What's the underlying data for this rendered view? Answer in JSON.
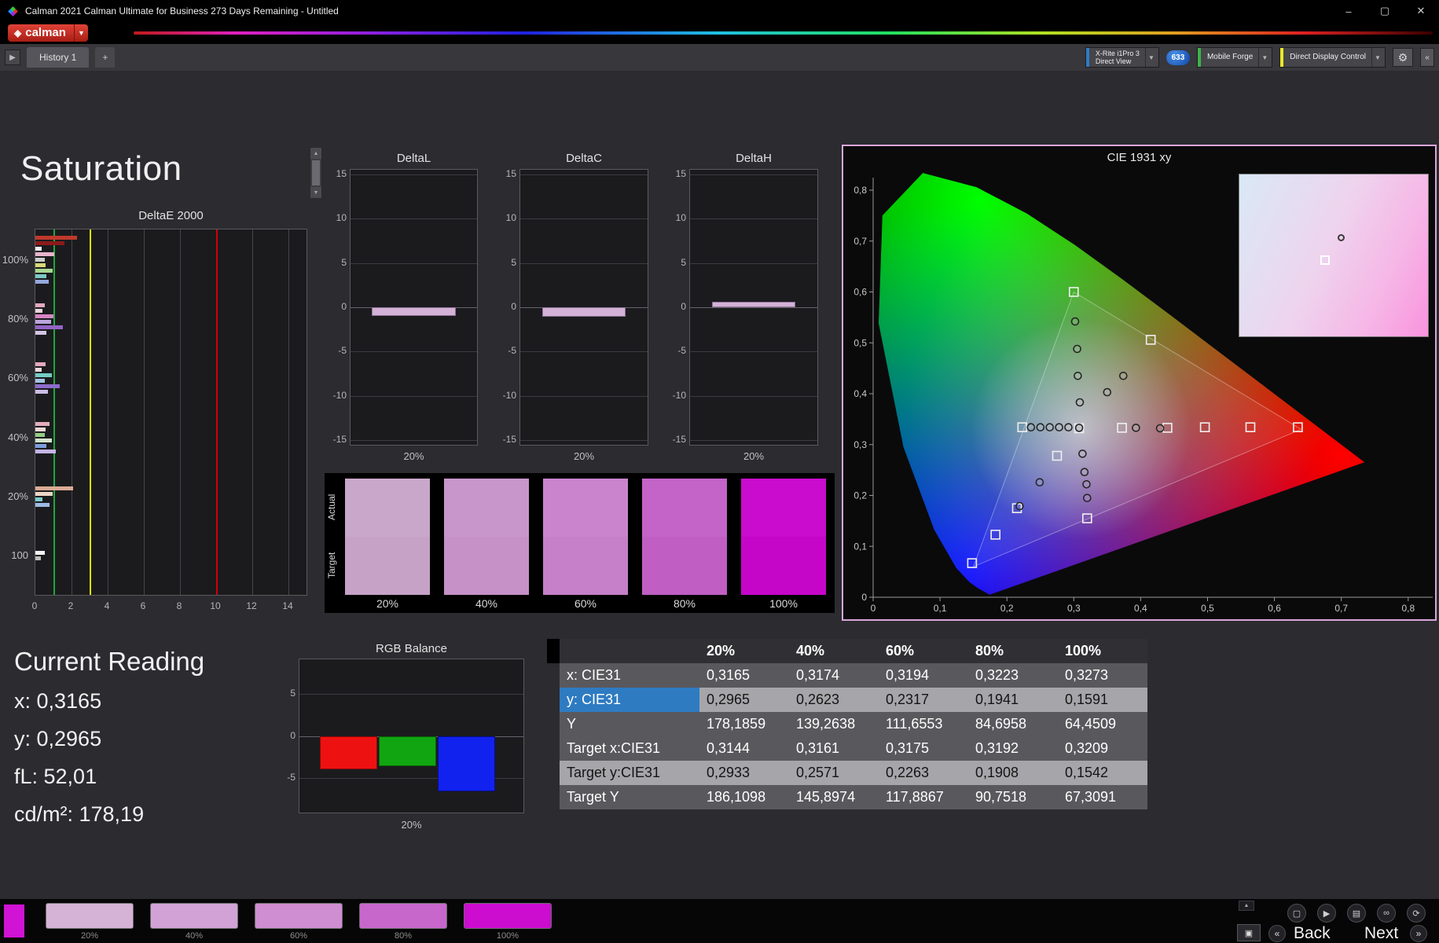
{
  "window": {
    "title": "Calman 2021 Calman Ultimate for Business 273 Days Remaining  - Untitled",
    "controls": {
      "minimize": "–",
      "maximize": "▢",
      "close": "✕"
    }
  },
  "logo": {
    "text": "calman",
    "diamond": "◈",
    "caret": "▼"
  },
  "tabbar": {
    "nav_arrow": "▶",
    "tabs": [
      {
        "label": "History 1"
      }
    ],
    "add_label": "+"
  },
  "meterbar": {
    "meter": {
      "line1": "X-Rite i1Pro 3",
      "line2": "Direct View",
      "accent": "#2f7cc4",
      "caret": "▼"
    },
    "badge": {
      "text": "633"
    },
    "source": {
      "label": "Mobile Forge",
      "accent": "#3cb44a",
      "caret": "▼"
    },
    "display_control": {
      "label": "Direct Display Control",
      "accent": "#e8e82a",
      "caret": "▼"
    },
    "gear": "⚙",
    "collapse": "«"
  },
  "page": {
    "title": "Saturation"
  },
  "current_reading": {
    "title": "Current Reading",
    "lines": [
      {
        "text": "x: 0,3165"
      },
      {
        "text": "y: 0,2965"
      },
      {
        "text": "fL: 52,01"
      },
      {
        "text": "cd/m²: 178,19"
      }
    ]
  },
  "bottombar": {
    "back_label": "Back",
    "next_label": "Next",
    "back_chevron": "«",
    "next_chevron": "»",
    "icons": [
      "▢",
      "▶",
      "▤",
      "∞",
      "⟳"
    ],
    "selected_color": "#d013d4",
    "thumbnails": [
      {
        "label": "20%",
        "color": "#d5b3d6"
      },
      {
        "label": "40%",
        "color": "#d2a1d5"
      },
      {
        "label": "60%",
        "color": "#cf8dd2"
      },
      {
        "label": "80%",
        "color": "#c767cb"
      },
      {
        "label": "100%",
        "color": "#cc0ccf"
      }
    ]
  },
  "chart_data": [
    {
      "id": "deltae2000",
      "type": "bar",
      "orientation": "horizontal",
      "title": "DeltaE 2000",
      "xlim": [
        0,
        15
      ],
      "xticks": [
        0,
        2,
        4,
        6,
        8,
        10,
        12,
        14
      ],
      "reference_lines": [
        {
          "value": 1,
          "color": "#1fa83c"
        },
        {
          "value": 3,
          "color": "#e8e000"
        },
        {
          "value": 10,
          "color": "#d40000"
        }
      ],
      "groups": [
        {
          "label": "100%",
          "bars": [
            {
              "color": "#c0392b",
              "value": 2.3
            },
            {
              "color": "#8b1a1a",
              "value": 1.6
            },
            {
              "color": "#f0f0f0",
              "value": 0.35
            },
            {
              "color": "#e8b4cc",
              "value": 1.05
            },
            {
              "color": "#cccccc",
              "value": 0.5
            },
            {
              "color": "#d8d878",
              "value": 0.55
            },
            {
              "color": "#a8d890",
              "value": 0.95
            },
            {
              "color": "#7cc8c4",
              "value": 0.6
            },
            {
              "color": "#94a8dc",
              "value": 0.75
            }
          ]
        },
        {
          "label": "80%",
          "bars": [
            {
              "color": "#e4a8bc",
              "value": 0.5
            },
            {
              "color": "#ecd4dc",
              "value": 0.4
            },
            {
              "color": "#d884c4",
              "value": 1.0
            },
            {
              "color": "#bca4dc",
              "value": 0.85
            },
            {
              "color": "#9464c4",
              "value": 1.5
            },
            {
              "color": "#d4c4e4",
              "value": 0.6
            }
          ]
        },
        {
          "label": "60%",
          "bars": [
            {
              "color": "#e4a8bc",
              "value": 0.55
            },
            {
              "color": "#ecd8dc",
              "value": 0.35
            },
            {
              "color": "#74ccc4",
              "value": 0.9
            },
            {
              "color": "#a4c4e4",
              "value": 0.5
            },
            {
              "color": "#8c6ccc",
              "value": 1.35
            },
            {
              "color": "#ccbce4",
              "value": 0.7
            }
          ]
        },
        {
          "label": "40%",
          "bars": [
            {
              "color": "#e4acbc",
              "value": 0.8
            },
            {
              "color": "#ecd8d4",
              "value": 0.55
            },
            {
              "color": "#94cc84",
              "value": 0.5
            },
            {
              "color": "#d4e4cc",
              "value": 0.9
            },
            {
              "color": "#7c9cdc",
              "value": 0.6
            },
            {
              "color": "#c4b4e4",
              "value": 1.15
            }
          ]
        },
        {
          "label": "20%",
          "bars": [
            {
              "color": "#dcac94",
              "value": 2.1
            },
            {
              "color": "#ecd4c4",
              "value": 0.95
            },
            {
              "color": "#7ccccc",
              "value": 0.4
            },
            {
              "color": "#9cbce4",
              "value": 0.8
            }
          ]
        },
        {
          "label": "100",
          "bars": [
            {
              "color": "#f4f4f4",
              "value": 0.5
            },
            {
              "color": "#bcbcbc",
              "value": 0.3
            }
          ]
        }
      ]
    },
    {
      "id": "deltaL",
      "type": "bar",
      "title": "DeltaL",
      "categories": [
        "20%"
      ],
      "values": [
        -1.0
      ],
      "ylim": [
        -15,
        15
      ],
      "yticks": [
        15,
        10,
        5,
        0,
        -5,
        -10,
        -15
      ],
      "bar_color": "#d2b2d6"
    },
    {
      "id": "deltaC",
      "type": "bar",
      "title": "DeltaC",
      "categories": [
        "20%"
      ],
      "values": [
        -1.1
      ],
      "ylim": [
        -15,
        15
      ],
      "yticks": [
        15,
        10,
        5,
        0,
        -5,
        -10,
        -15
      ],
      "bar_color": "#d2b2d6"
    },
    {
      "id": "deltaH",
      "type": "bar",
      "title": "DeltaH",
      "categories": [
        "20%"
      ],
      "values": [
        0.6
      ],
      "ylim": [
        -15,
        15
      ],
      "yticks": [
        15,
        10,
        5,
        0,
        -5,
        -10,
        -15
      ],
      "bar_color": "#d2b2d6"
    },
    {
      "id": "swatches",
      "type": "table",
      "title": "",
      "row_labels": [
        "Actual",
        "Target"
      ],
      "columns": [
        "20%",
        "40%",
        "60%",
        "80%",
        "100%"
      ],
      "actual_colors": [
        "#c9a7ca",
        "#c996cb",
        "#ca84cd",
        "#c463c8",
        "#c90ccd"
      ],
      "target_colors": [
        "#c5a2c6",
        "#c591c7",
        "#c67fc9",
        "#c05ec4",
        "#c506c9"
      ]
    },
    {
      "id": "cie1931",
      "type": "scatter",
      "title": "CIE 1931 xy",
      "xlim": [
        0,
        0.8
      ],
      "ylim": [
        0,
        0.8
      ],
      "xticks": [
        "0",
        "0,1",
        "0,2",
        "0,3",
        "0,4",
        "0,5",
        "0,6",
        "0,7",
        "0,8"
      ],
      "yticks": [
        "0",
        "0,1",
        "0,2",
        "0,3",
        "0,4",
        "0,5",
        "0,6",
        "0,7",
        "0,8"
      ],
      "spectral_locus": [
        [
          0.1741,
          0.005
        ],
        [
          0.1566,
          0.0177
        ],
        [
          0.144,
          0.0297
        ],
        [
          0.1241,
          0.0578
        ],
        [
          0.0913,
          0.1327
        ],
        [
          0.0454,
          0.295
        ],
        [
          0.0082,
          0.5384
        ],
        [
          0.0139,
          0.7502
        ],
        [
          0.0743,
          0.8338
        ],
        [
          0.1547,
          0.8059
        ],
        [
          0.2296,
          0.7543
        ],
        [
          0.3016,
          0.6923
        ],
        [
          0.3731,
          0.6245
        ],
        [
          0.4441,
          0.5547
        ],
        [
          0.5125,
          0.4866
        ],
        [
          0.5752,
          0.4242
        ],
        [
          0.627,
          0.3725
        ],
        [
          0.6658,
          0.334
        ],
        [
          0.6915,
          0.3083
        ],
        [
          0.7079,
          0.292
        ],
        [
          0.719,
          0.2809
        ],
        [
          0.7347,
          0.2653
        ]
      ],
      "gamut_triangle": [
        [
          0.64,
          0.33
        ],
        [
          0.3,
          0.6
        ],
        [
          0.15,
          0.06
        ]
      ],
      "white_point": [
        0.308,
        0.332
      ],
      "targets": [
        [
          0.3,
          0.6
        ],
        [
          0.415,
          0.506
        ],
        [
          0.372,
          0.333
        ],
        [
          0.44,
          0.333
        ],
        [
          0.496,
          0.334
        ],
        [
          0.564,
          0.334
        ],
        [
          0.635,
          0.334
        ],
        [
          0.223,
          0.334
        ],
        [
          0.308,
          0.332
        ],
        [
          0.275,
          0.278
        ],
        [
          0.32,
          0.155
        ],
        [
          0.215,
          0.175
        ],
        [
          0.183,
          0.123
        ],
        [
          0.148,
          0.067
        ]
      ],
      "measurements": [
        [
          0.302,
          0.542
        ],
        [
          0.305,
          0.488
        ],
        [
          0.306,
          0.435
        ],
        [
          0.309,
          0.383
        ],
        [
          0.374,
          0.435
        ],
        [
          0.35,
          0.403
        ],
        [
          0.393,
          0.333
        ],
        [
          0.429,
          0.332
        ],
        [
          0.236,
          0.334
        ],
        [
          0.25,
          0.334
        ],
        [
          0.264,
          0.334
        ],
        [
          0.278,
          0.334
        ],
        [
          0.292,
          0.334
        ],
        [
          0.308,
          0.333
        ],
        [
          0.313,
          0.282
        ],
        [
          0.316,
          0.246
        ],
        [
          0.319,
          0.222
        ],
        [
          0.32,
          0.195
        ],
        [
          0.249,
          0.226
        ],
        [
          0.219,
          0.179
        ]
      ],
      "inset": {
        "circle": [
          0.52,
          0.37
        ],
        "square": [
          0.43,
          0.5
        ]
      }
    },
    {
      "id": "rgb_balance",
      "type": "bar",
      "title": "RGB Balance",
      "categories": [
        "20%"
      ],
      "ylim": [
        -8,
        8
      ],
      "yticks": [
        5,
        0,
        -5
      ],
      "series": [
        {
          "name": "Red",
          "color": "#ee1111",
          "border": "#8a0808",
          "values": [
            -4.0
          ]
        },
        {
          "name": "Green",
          "color": "#11a611",
          "border": "#075e07",
          "values": [
            -3.6
          ]
        },
        {
          "name": "Blue",
          "color": "#1122ee",
          "border": "#080e8a",
          "values": [
            -6.6
          ]
        }
      ]
    },
    {
      "id": "readings_table",
      "type": "table",
      "title": "",
      "columns": [
        "20%",
        "40%",
        "60%",
        "80%",
        "100%"
      ],
      "shades": [
        "dark",
        "light",
        "dark",
        "dark",
        "light",
        "dark"
      ],
      "selected_row": 1,
      "rows": [
        {
          "label": "x: CIE31",
          "values": [
            "0,3165",
            "0,3174",
            "0,3194",
            "0,3223",
            "0,3273"
          ]
        },
        {
          "label": "y: CIE31",
          "values": [
            "0,2965",
            "0,2623",
            "0,2317",
            "0,1941",
            "0,1591"
          ]
        },
        {
          "label": "Y",
          "values": [
            "178,1859",
            "139,2638",
            "111,6553",
            "84,6958",
            "64,4509"
          ]
        },
        {
          "label": "Target x:CIE31",
          "values": [
            "0,3144",
            "0,3161",
            "0,3175",
            "0,3192",
            "0,3209"
          ]
        },
        {
          "label": "Target y:CIE31",
          "values": [
            "0,2933",
            "0,2571",
            "0,2263",
            "0,1908",
            "0,1542"
          ]
        },
        {
          "label": "Target Y",
          "values": [
            "186,1098",
            "145,8974",
            "117,8867",
            "90,7518",
            "67,3091"
          ]
        }
      ]
    }
  ]
}
